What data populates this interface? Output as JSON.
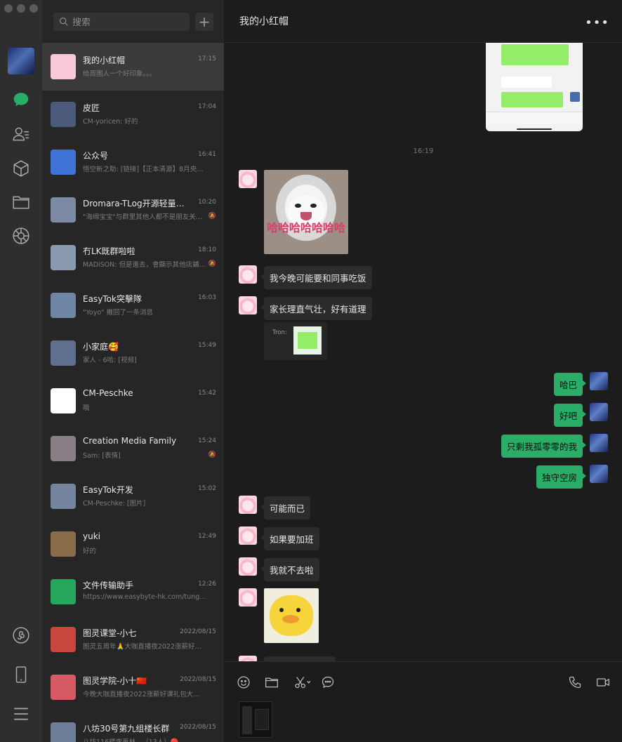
{
  "rail": {
    "icons": [
      "chat-icon",
      "contacts-icon",
      "favorites-icon",
      "files-icon",
      "moments-icon",
      "mini-program-icon",
      "phone-icon",
      "menu-icon"
    ]
  },
  "search": {
    "placeholder": "搜索"
  },
  "chats": [
    {
      "name": "我的小红帽",
      "time": "17:15",
      "preview": "给周围人一个好印象。。。",
      "active": true,
      "avatar_color": "#f8c9d6"
    },
    {
      "name": "皮匠",
      "time": "17:04",
      "preview": "CM-yoricen: 好的",
      "avatar_color": "#4b5a7a"
    },
    {
      "name": "公众号",
      "time": "16:41",
      "preview": "悟空新之助: [链接]【正本清源】8月央行净...",
      "avatar_color": "#3f74d6"
    },
    {
      "name": "Dromara-TLog开源轻量级日...",
      "time": "10:20",
      "preview": "\"海绵宝宝\"与群里其他人都不是朋友关系...",
      "muted": true,
      "avatar_color": "#7d8aa3"
    },
    {
      "name": "冇LK既群啦啦",
      "time": "18:10",
      "preview": "MADiSON: 但是進去，會顯示其他店鋪...",
      "muted": true,
      "avatar_color": "#8a9bb0"
    },
    {
      "name": "EasyTok突擊隊",
      "time": "16:03",
      "preview": "\"Yoyo\" 撤回了一条消息",
      "avatar_color": "#6f85a6"
    },
    {
      "name": "小家庭🥰",
      "time": "15:49",
      "preview": "家人 - 6哈: [视频]",
      "avatar_color": "#5e6f8f"
    },
    {
      "name": "CM-Peschke",
      "time": "15:42",
      "preview": "哦",
      "avatar_color": "#ffffff"
    },
    {
      "name": "Creation Media Family",
      "time": "15:24",
      "preview": "Sam: [表情]",
      "muted": true,
      "avatar_color": "#8a7f86"
    },
    {
      "name": "EasyTok开发",
      "time": "15:02",
      "preview": "CM-Peschke: [图片]",
      "avatar_color": "#7585a0"
    },
    {
      "name": "yuki",
      "time": "12:49",
      "preview": "好的",
      "avatar_color": "#8a6b4a"
    },
    {
      "name": "文件传输助手",
      "time": "12:26",
      "preview": "https://www.easybyte-hk.com/tungshing/#/",
      "avatar_color": "#26a55c"
    },
    {
      "name": "图灵课堂-小七",
      "time": "2022/08/15",
      "preview": "图灵五周年🙏大咖直播夜2022涨薪好课礼...",
      "avatar_color": "#c9463e"
    },
    {
      "name": "图灵学院-小十🇨🇳",
      "time": "2022/08/15",
      "preview": "今晚大咖直播夜2022涨薪好课礼包大派送—...",
      "avatar_color": "#d55a64"
    },
    {
      "name": "八坊30号第九组楼长群",
      "time": "2022/08/15",
      "preview": "八坊116楼李再林...（13人）🔴",
      "avatar_color": "#6d7e99"
    }
  ],
  "main": {
    "title": "我的小红帽",
    "timestamp": "16:19",
    "cat_caption": "哈哈哈哈哈哈哈",
    "messages": [
      {
        "side": "left",
        "text": "我今晚可能要和同事吃饭"
      },
      {
        "side": "left",
        "text": "家长理直气壮，好有道理"
      },
      {
        "side": "right",
        "text": "哈巴"
      },
      {
        "side": "right",
        "text": "好吧"
      },
      {
        "side": "right",
        "text": "只剩我孤零零的我"
      },
      {
        "side": "right",
        "text": "独守空房"
      },
      {
        "side": "left",
        "text": "可能而已"
      },
      {
        "side": "left",
        "text": "如果要加班"
      },
      {
        "side": "left",
        "text": "我就不去啦"
      }
    ],
    "quote_label": "Tron:"
  },
  "composer": {
    "tools": [
      "emoji-icon",
      "folder-icon",
      "scissors-icon",
      "chat-bubble-icon",
      "phone-call-icon",
      "video-call-icon"
    ]
  },
  "colors": {
    "accent_green": "#2aae67",
    "bg_main": "#1c1c1c",
    "bg_list": "#262626",
    "bg_rail": "#2e2e2e"
  }
}
